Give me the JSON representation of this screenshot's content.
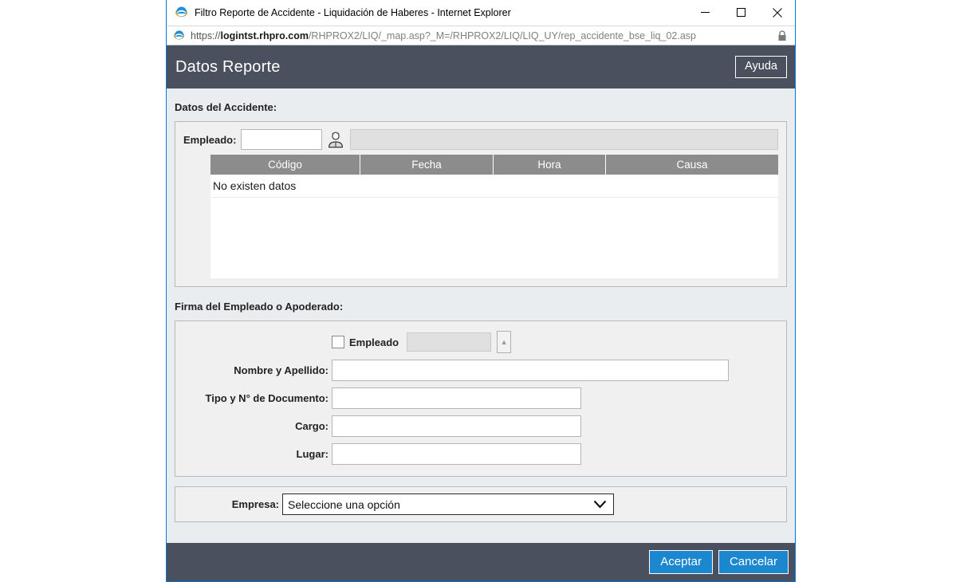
{
  "window": {
    "title": "Filtro Reporte de Accidente - Liquidación de Haberes - Internet Explorer",
    "browser_icon": "internet-explorer-icon",
    "controls": {
      "minimize": "minimize-icon",
      "maximize": "maximize-icon",
      "close": "close-icon"
    },
    "address_bar": {
      "scheme": "https://",
      "host": "logintst.rhpro.com",
      "path": "/RHPROX2/LIQ/_map.asp?_M=/RHPROX2/LIQ/LIQ_UY/rep_accidente_bse_liq_02.asp",
      "full_url": "https://logintst.rhpro.com/RHPROX2/LIQ/_map.asp?_M=/RHPROX2/LIQ/LIQ_UY/rep_accidente_bse_liq_02.asp",
      "security_icon": "lock-icon"
    }
  },
  "header": {
    "title": "Datos Reporte",
    "help_label": "Ayuda"
  },
  "accident_section": {
    "label": "Datos del Accidente:",
    "employee": {
      "label": "Empleado:",
      "code_value": "",
      "code_placeholder": "",
      "picker_icon": "person-picker-icon",
      "name_value": ""
    },
    "grid": {
      "columns": [
        "Código",
        "Fecha",
        "Hora",
        "Causa"
      ],
      "empty_message": "No existen datos",
      "rows": []
    }
  },
  "signature_section": {
    "label": "Firma del Empleado o Apoderado:",
    "employee_checkbox": {
      "label": "Empleado",
      "checked": false,
      "linked_value": "",
      "expand_button_icon": "broken-image-icon"
    },
    "fields": [
      {
        "label": "Nombre y Apellido:",
        "value": "",
        "width": "wide"
      },
      {
        "label": "Tipo y N° de Documento:",
        "value": "",
        "width": "mid"
      },
      {
        "label": "Cargo:",
        "value": "",
        "width": "mid"
      },
      {
        "label": "Lugar:",
        "value": "",
        "width": "mid"
      }
    ]
  },
  "company_section": {
    "label": "Empresa:",
    "selected_option": "Seleccione una opción",
    "caret_icon": "chevron-down-icon"
  },
  "footer": {
    "accept_label": "Aceptar",
    "cancel_label": "Cancelar"
  },
  "colors": {
    "header_bar": "#4a505e",
    "primary_button": "#1b87ce",
    "grid_header": "#8c8c8c",
    "panel_background": "#f0f0f0",
    "app_background": "#e9edef",
    "window_border": "#0078d7"
  }
}
